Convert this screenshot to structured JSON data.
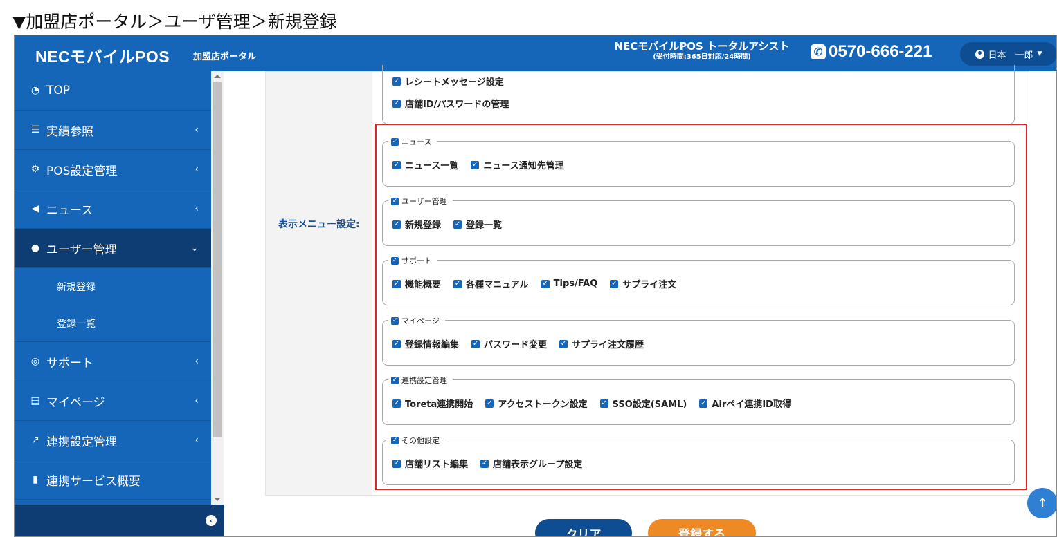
{
  "caption": "▼加盟店ポータル＞ユーザ管理＞新規登録",
  "header": {
    "brand": "NECモバイルPOS",
    "brand_sub": "加盟店ポータル",
    "assist_title": "NECモバイルPOS トータルアシスト",
    "assist_hours": "(受付時間:365日対応/24時間)",
    "phone": "0570-666-221",
    "user_name": "日本　一郎"
  },
  "sidebar": {
    "items": [
      {
        "label": "TOP",
        "icon": "dashboard-icon"
      },
      {
        "label": "実績参照",
        "icon": "list-icon"
      },
      {
        "label": "POS設定管理",
        "icon": "gear-icon"
      },
      {
        "label": "ニュース",
        "icon": "megaphone-icon"
      },
      {
        "label": "ユーザー管理",
        "icon": "user-add-icon"
      },
      {
        "label": "サポート",
        "icon": "lifebuoy-icon"
      },
      {
        "label": "マイページ",
        "icon": "id-card-icon"
      },
      {
        "label": "連携設定管理",
        "icon": "external-link-icon"
      },
      {
        "label": "連携サービス概要",
        "icon": "building-icon"
      }
    ],
    "sub_items": [
      "新規登録",
      "登録一覧"
    ]
  },
  "form": {
    "label": "表示メニュー設定:",
    "top_items": [
      "レシートメッセージ設定",
      "店舗ID/パスワードの管理"
    ],
    "groups": [
      {
        "legend": "ニュース",
        "items": [
          "ニュース一覧",
          "ニュース通知先管理"
        ]
      },
      {
        "legend": "ユーザー管理",
        "items": [
          "新規登録",
          "登録一覧"
        ]
      },
      {
        "legend": "サポート",
        "items": [
          "機能概要",
          "各種マニュアル",
          "Tips/FAQ",
          "サプライ注文"
        ]
      },
      {
        "legend": "マイページ",
        "items": [
          "登録情報編集",
          "パスワード変更",
          "サプライ注文履歴"
        ]
      },
      {
        "legend": "連携設定管理",
        "items": [
          "Toreta連携開始",
          "アクセストークン設定",
          "SSO設定(SAML)",
          "Airペイ連携ID取得"
        ]
      },
      {
        "legend": "その他設定",
        "items": [
          "店舗リスト編集",
          "店舗表示グループ設定"
        ]
      }
    ]
  },
  "buttons": {
    "clear": "クリア",
    "register": "登録する"
  },
  "colors": {
    "primary": "#1565b8",
    "sidebar_active": "#0e3d73",
    "accent_orange": "#ee8a25",
    "highlight_red": "#e0242b"
  }
}
